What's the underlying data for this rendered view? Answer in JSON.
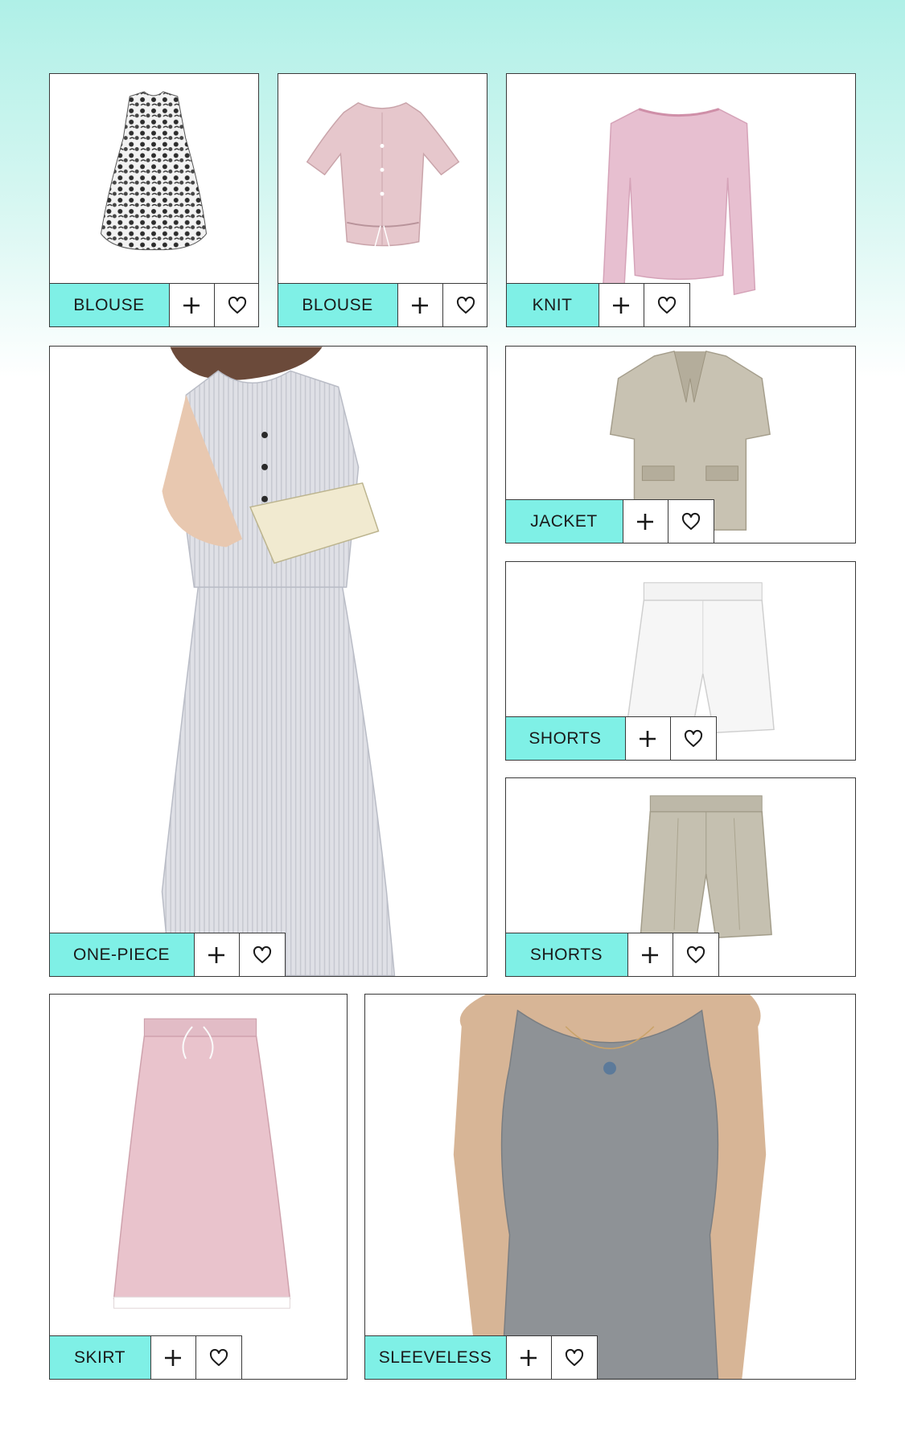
{
  "items": [
    {
      "category": "BLOUSE",
      "product": "paisley-sleeveless-blouse",
      "accent": "#7ff0e6",
      "add_icon": "plus-icon",
      "like_icon": "heart-icon"
    },
    {
      "category": "BLOUSE",
      "product": "pink-ruffle-blouse",
      "accent": "#7ff0e6",
      "add_icon": "plus-icon",
      "like_icon": "heart-icon"
    },
    {
      "category": "KNIT",
      "product": "pink-knit-top",
      "accent": "#7ff0e6",
      "add_icon": "plus-icon",
      "like_icon": "heart-icon"
    },
    {
      "category": "ONE-PIECE",
      "product": "grey-stripe-two-piece",
      "accent": "#7ff0e6",
      "add_icon": "plus-icon",
      "like_icon": "heart-icon"
    },
    {
      "category": "JACKET",
      "product": "linen-short-sleeve-jacket",
      "accent": "#7ff0e6",
      "add_icon": "plus-icon",
      "like_icon": "heart-icon"
    },
    {
      "category": "SHORTS",
      "product": "white-wide-shorts",
      "accent": "#7ff0e6",
      "add_icon": "plus-icon",
      "like_icon": "heart-icon"
    },
    {
      "category": "SHORTS",
      "product": "khaki-pleated-shorts",
      "accent": "#7ff0e6",
      "add_icon": "plus-icon",
      "like_icon": "heart-icon"
    },
    {
      "category": "SKIRT",
      "product": "pink-drawstring-skirt",
      "accent": "#7ff0e6",
      "add_icon": "plus-icon",
      "like_icon": "heart-icon"
    },
    {
      "category": "SLEEVELESS",
      "product": "grey-knit-tank",
      "accent": "#7ff0e6",
      "add_icon": "plus-icon",
      "like_icon": "heart-icon"
    }
  ],
  "colors": {
    "background_top": "#aff0e7",
    "label_background": "#7ff0e6",
    "border": "#3a3a3a"
  }
}
